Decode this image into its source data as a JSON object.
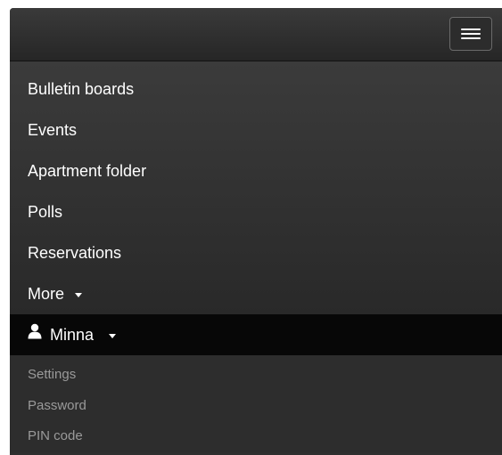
{
  "navbar": {
    "toggle_icon": "hamburger-menu-icon"
  },
  "menu": {
    "items": [
      {
        "label": "Bulletin boards"
      },
      {
        "label": "Events"
      },
      {
        "label": "Apartment folder"
      },
      {
        "label": "Polls"
      },
      {
        "label": "Reservations"
      }
    ],
    "more_label": "More"
  },
  "user": {
    "name": "Minna",
    "icon": "user-icon",
    "dropdown": {
      "items": [
        {
          "label": "Settings"
        },
        {
          "label": "Password"
        },
        {
          "label": "PIN code"
        }
      ]
    }
  },
  "colors": {
    "navbar_bg": "#2f2f2f",
    "active_bg": "#070707",
    "menu_text": "#ffffff",
    "submenu_text": "#9a9a9a"
  }
}
